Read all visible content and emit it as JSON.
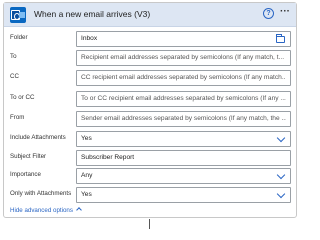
{
  "header": {
    "title": "When a new email arrives (V3)",
    "icons": {
      "app": "outlook-icon",
      "help": "help-icon",
      "more": "more-icon"
    },
    "help_glyph": "?",
    "more_glyph": "···"
  },
  "fields": [
    {
      "label": "Folder",
      "value": "Inbox",
      "placeholder": "",
      "control": "folder-picker"
    },
    {
      "label": "To",
      "value": "",
      "placeholder": "Recipient email addresses separated by semicolons (If any match, t...",
      "control": "text"
    },
    {
      "label": "CC",
      "value": "",
      "placeholder": "CC recipient email addresses separated by semicolons (If any match...",
      "control": "text"
    },
    {
      "label": "To or CC",
      "value": "",
      "placeholder": "To or CC recipient email addresses separated by semicolons (If any ...",
      "control": "text"
    },
    {
      "label": "From",
      "value": "",
      "placeholder": "Sender email addresses separated by semicolons (If any match, the ...",
      "control": "text"
    },
    {
      "label": "Include Attachments",
      "value": "Yes",
      "placeholder": "",
      "control": "dropdown"
    },
    {
      "label": "Subject Filter",
      "value": "Subscriber Report",
      "placeholder": "",
      "control": "text"
    },
    {
      "label": "Importance",
      "value": "Any",
      "placeholder": "",
      "control": "dropdown"
    },
    {
      "label": "Only with Attachments",
      "value": "Yes",
      "placeholder": "",
      "control": "dropdown"
    }
  ],
  "footer": {
    "advanced_label": "Hide advanced options"
  },
  "colors": {
    "header_bg": "#dde6f3",
    "accent": "#2b66c4",
    "outlook": "#0a68c1"
  }
}
